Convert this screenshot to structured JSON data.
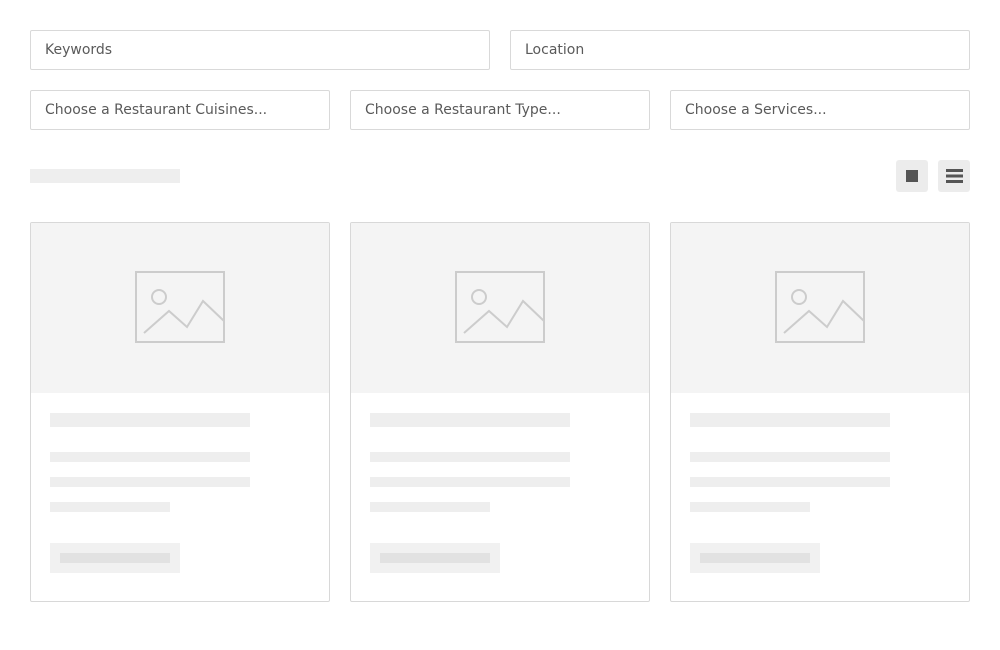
{
  "search": {
    "keywords_placeholder": "Keywords",
    "location_placeholder": "Location",
    "cuisines_placeholder": "Choose a Restaurant Cuisines...",
    "type_placeholder": "Choose a Restaurant Type...",
    "services_placeholder": "Choose a Services..."
  },
  "toolbar": {
    "grid_view_icon": "grid-icon",
    "list_view_icon": "list-icon",
    "active_view": "grid"
  },
  "colors": {
    "border": "#d9d9d9",
    "skeleton": "#eeeeee",
    "image_placeholder_bg": "#f4f4f4",
    "icon": "#555555",
    "placeholder_icon": "#cccccc"
  },
  "listings": [
    {
      "state": "loading",
      "image_icon": "image-placeholder-icon"
    },
    {
      "state": "loading",
      "image_icon": "image-placeholder-icon"
    },
    {
      "state": "loading",
      "image_icon": "image-placeholder-icon"
    }
  ]
}
